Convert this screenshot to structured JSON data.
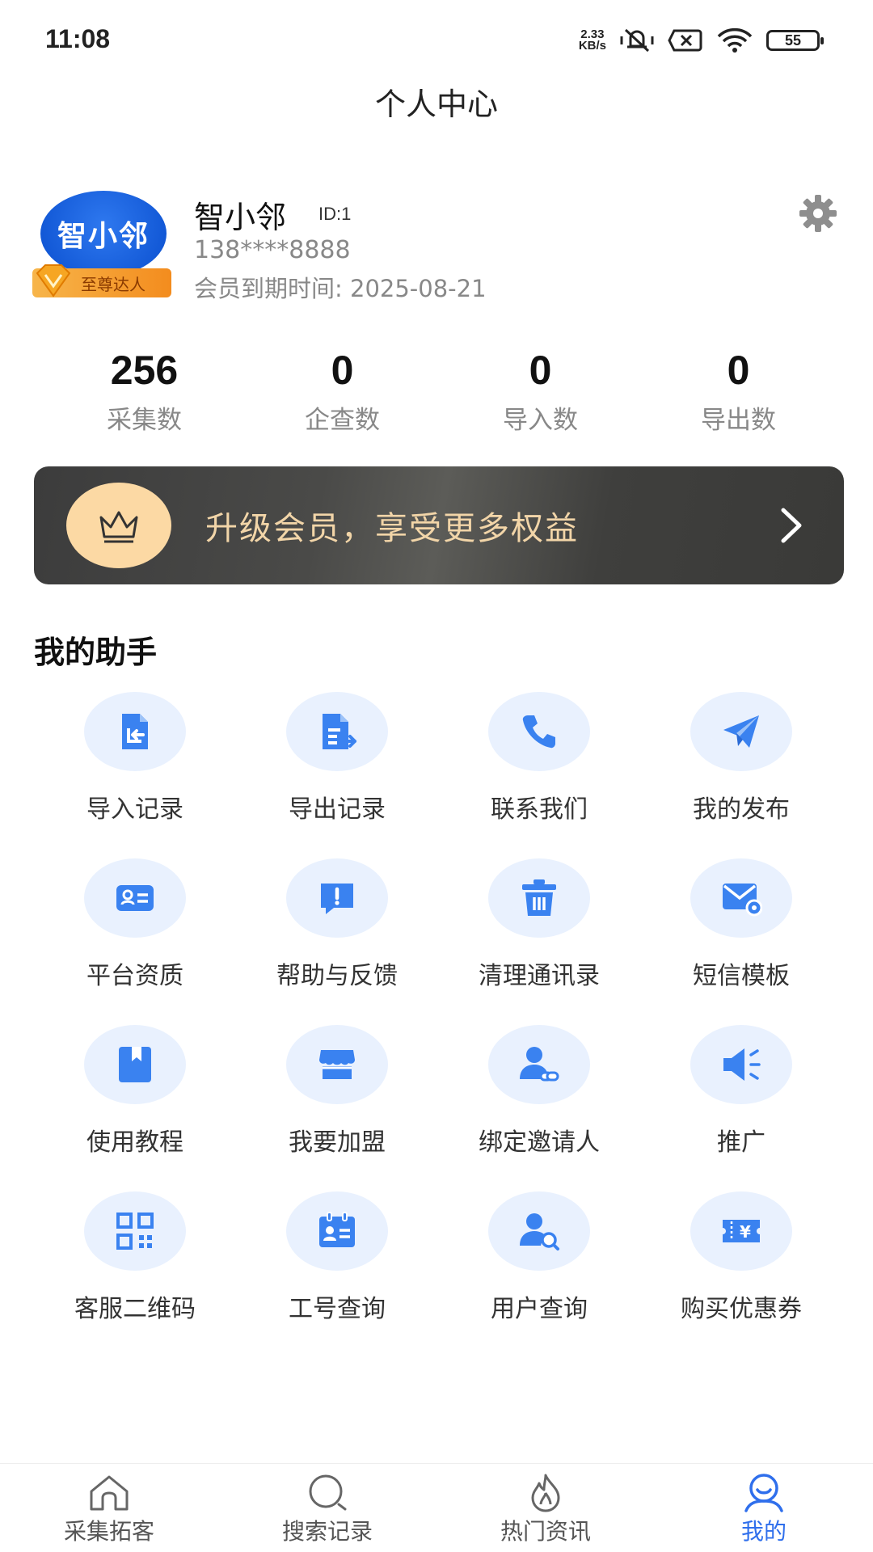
{
  "status_bar": {
    "time": "11:08",
    "net_speed_value": "2.33",
    "net_speed_unit": "KB/s",
    "battery": "55"
  },
  "header": {
    "title": "个人中心"
  },
  "profile": {
    "avatar_text": "智小邻",
    "vip_level": "至尊达人",
    "name": "智小邻",
    "id": "ID:1",
    "phone": "138****8888",
    "expire": "会员到期时间: 2025-08-21"
  },
  "stats": [
    {
      "value": "256",
      "label": "采集数"
    },
    {
      "value": "0",
      "label": "企查数"
    },
    {
      "value": "0",
      "label": "导入数"
    },
    {
      "value": "0",
      "label": "导出数"
    }
  ],
  "upgrade_banner": {
    "text": "升级会员，享受更多权益"
  },
  "assistant": {
    "title": "我的助手",
    "items": [
      {
        "label": "导入记录",
        "icon": "import-doc-icon"
      },
      {
        "label": "导出记录",
        "icon": "export-doc-icon"
      },
      {
        "label": "联系我们",
        "icon": "phone-icon"
      },
      {
        "label": "我的发布",
        "icon": "paper-plane-icon"
      },
      {
        "label": "平台资质",
        "icon": "id-card-icon"
      },
      {
        "label": "帮助与反馈",
        "icon": "feedback-icon"
      },
      {
        "label": "清理通讯录",
        "icon": "trash-icon"
      },
      {
        "label": "短信模板",
        "icon": "mail-gear-icon"
      },
      {
        "label": "使用教程",
        "icon": "bookmark-book-icon"
      },
      {
        "label": "我要加盟",
        "icon": "store-icon"
      },
      {
        "label": "绑定邀请人",
        "icon": "user-link-icon"
      },
      {
        "label": "推广",
        "icon": "megaphone-icon"
      },
      {
        "label": "客服二维码",
        "icon": "qr-code-icon"
      },
      {
        "label": "工号查询",
        "icon": "badge-card-icon"
      },
      {
        "label": "用户查询",
        "icon": "user-search-icon"
      },
      {
        "label": "购买优惠券",
        "icon": "coupon-icon"
      }
    ]
  },
  "tabbar": {
    "items": [
      {
        "label": "采集拓客",
        "icon": "home-icon"
      },
      {
        "label": "搜索记录",
        "icon": "search-icon"
      },
      {
        "label": "热门资讯",
        "icon": "flame-icon"
      },
      {
        "label": "我的",
        "icon": "user-smile-icon"
      }
    ],
    "active_index": 3
  },
  "colors": {
    "accent": "#2f6fec",
    "icon_blue": "#3a82f0",
    "icon_bg": "#e9f1fe",
    "banner_text": "#f2d5a8",
    "banner_circle": "#fcd9a4"
  }
}
